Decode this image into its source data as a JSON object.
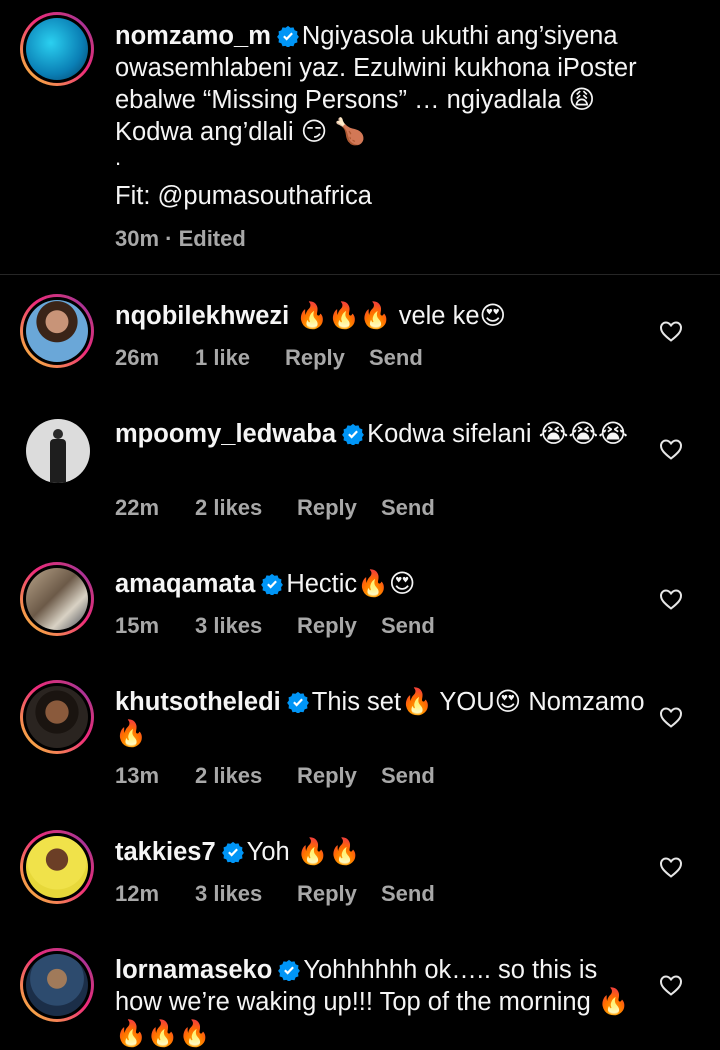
{
  "post": {
    "username": "nomzamo_m",
    "caption_text": "Ngiyasola ukuthi ang’siyena owasemhlabeni yaz. Ezulwini kukhona iPoster ebalwe “Missing Persons” … ngiyadlala 😩 Kodwa ang’dlali 😏 🍗",
    "caption_dot": ".",
    "caption_fit": "Fit: @pumasouthafrica",
    "meta": "30m · Edited"
  },
  "comments": [
    {
      "username": "nqobilekhwezi",
      "verified": false,
      "text": "🔥🔥🔥 vele ke😍",
      "time": "26m",
      "likes": "1 like",
      "reply": "Reply",
      "send": "Send"
    },
    {
      "username": "mpoomy_ledwaba",
      "verified": true,
      "text": "Kodwa sifelani 😭😭😭",
      "time": "22m",
      "likes": "2 likes",
      "reply": "Reply",
      "send": "Send"
    },
    {
      "username": "amaqamata",
      "verified": true,
      "text": "Hectic🔥😍",
      "time": "15m",
      "likes": "3 likes",
      "reply": "Reply",
      "send": "Send"
    },
    {
      "username": "khutsotheledi",
      "verified": true,
      "text": "This set🔥 YOU😍 Nomzamo 🔥",
      "time": "13m",
      "likes": "2 likes",
      "reply": "Reply",
      "send": "Send"
    },
    {
      "username": "takkies7",
      "verified": true,
      "text": "Yoh 🔥🔥",
      "time": "12m",
      "likes": "3 likes",
      "reply": "Reply",
      "send": "Send"
    },
    {
      "username": "lornamaseko",
      "verified": true,
      "text": "Yohhhhhh ok….. so this is how we’re waking up!!! Top of the morning 🔥🔥🔥🔥",
      "time": "",
      "likes": "",
      "reply": "",
      "send": ""
    }
  ],
  "colors": {
    "background": "#000000",
    "text": "#f5f5f5",
    "muted": "#a8a8a8",
    "verified": "#0095f6"
  },
  "icons": {
    "verified": "verified-badge-icon",
    "like": "heart-outline-icon"
  }
}
